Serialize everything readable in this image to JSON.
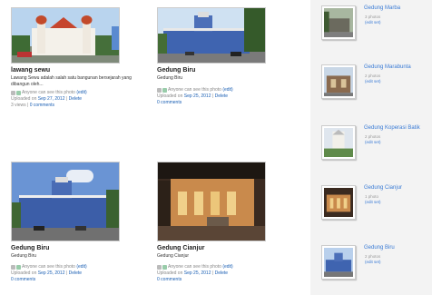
{
  "photos": [
    {
      "title": "lawang sewu",
      "description": "Lawang Sewu adalah salah satu bangunan bersejarah yang dibangun oleh...",
      "privacy": "Anyone can see this photo",
      "edit": "(edit)",
      "uploaded_prefix": "Uploaded on",
      "uploaded_date": "Sep 27, 2012",
      "delete": "Delete",
      "views": "3 views",
      "comments": "0 comments"
    },
    {
      "title": "Gedung Biru",
      "description": "Gedung Biru",
      "privacy": "Anyone can see this photo",
      "edit": "(edit)",
      "uploaded_prefix": "Uploaded on",
      "uploaded_date": "Sep 25, 2012",
      "delete": "Delete",
      "comments": "0 comments"
    },
    {
      "title": "Gedung Biru",
      "description": "Gedung Biru",
      "privacy": "Anyone can see this photo",
      "edit": "(edit)",
      "uploaded_prefix": "Uploaded on",
      "uploaded_date": "Sep 25, 2012",
      "delete": "Delete",
      "comments": "0 comments"
    },
    {
      "title": "Gedung Cianjur",
      "description": "Gedung Cianjur",
      "privacy": "Anyone can see this photo",
      "edit": "(edit)",
      "uploaded_prefix": "Uploaded on",
      "uploaded_date": "Sep 25, 2012",
      "delete": "Delete",
      "comments": "0 comments"
    }
  ],
  "sets": [
    {
      "name": "Gedung Marba",
      "count": "3 photos",
      "edit": "(edit set)"
    },
    {
      "name": "Gedung Marabunta",
      "count": "2 photos",
      "edit": "(edit set)"
    },
    {
      "name": "Gedung Koperasi Batik",
      "count": "2 photos",
      "edit": "(edit set)"
    },
    {
      "name": "Gedung Cianjur",
      "count": "1 photo",
      "edit": "(edit set)"
    },
    {
      "name": "Gedung Biru",
      "count": "2 photos",
      "edit": "(edit set)"
    }
  ],
  "colors": {
    "link": "#1a5fb4",
    "set_link": "#3a7bd5",
    "sidebar_bg": "#f3f3f3"
  }
}
